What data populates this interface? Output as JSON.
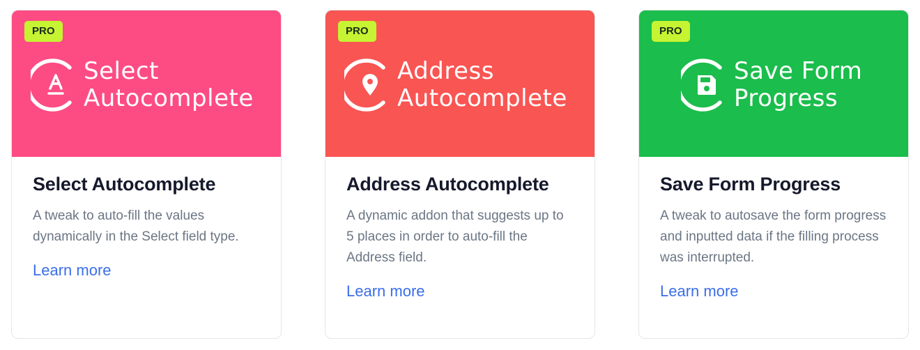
{
  "colors": {
    "card1_banner": "#fd4c83",
    "card2_banner": "#f95553",
    "card3_banner": "#1bbd4c",
    "pro_badge": "#c6f432",
    "link": "#3a6ee8"
  },
  "cards": [
    {
      "badge": "PRO",
      "logo_icon": "select-letter-a-icon",
      "logo_line1": "Select",
      "logo_line2": "Autocomplete",
      "title": "Select Autocomplete",
      "description": "A tweak to auto-fill the values dynamically in the Select field type.",
      "link": "Learn more"
    },
    {
      "badge": "PRO",
      "logo_icon": "map-pin-icon",
      "logo_line1": "Address",
      "logo_line2": "Autocomplete",
      "title": "Address Autocomplete",
      "description": "A dynamic addon that suggests up to 5 places in order to auto-fill the Address field.",
      "link": "Learn more"
    },
    {
      "badge": "PRO",
      "logo_icon": "floppy-disk-icon",
      "logo_line1": "Save Form",
      "logo_line2": "Progress",
      "title": "Save Form Progress",
      "description": "A tweak to autosave the form progress and inputted data if the filling process was interrupted.",
      "link": "Learn more"
    }
  ]
}
